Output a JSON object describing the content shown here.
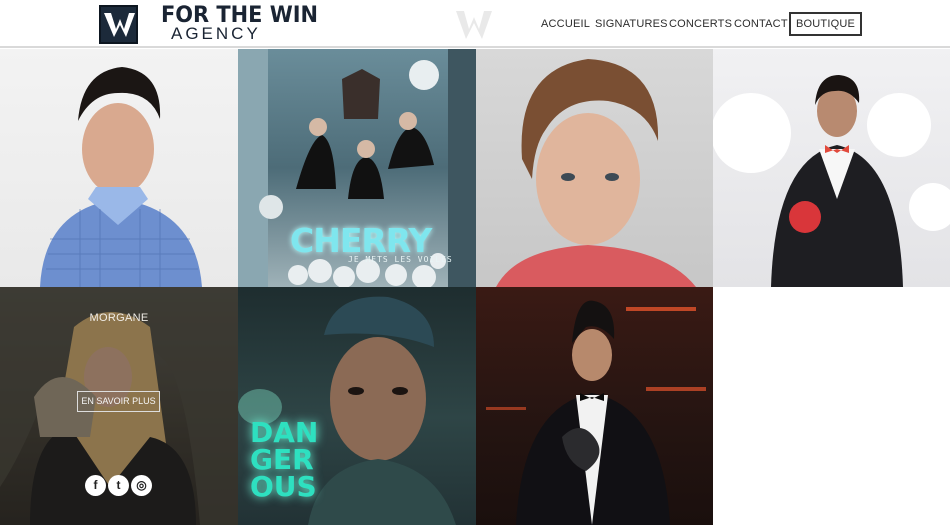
{
  "brand": {
    "line1": "FOR THE WIN",
    "line2": "AGENCY",
    "logo_icon": "w-logo-icon"
  },
  "nav": [
    {
      "label": "ACCUEIL"
    },
    {
      "label": "SIGNATURES"
    },
    {
      "label": "CONCERTS"
    },
    {
      "label": "CONTACT"
    },
    {
      "label": "BOUTIQUE"
    }
  ],
  "tiles": [
    {
      "id": "artist-1"
    },
    {
      "id": "artist-2",
      "title": "CHERRY",
      "subtitle": "JE METS LES VOILES"
    },
    {
      "id": "artist-3"
    },
    {
      "id": "artist-4"
    },
    {
      "id": "artist-5",
      "name": "MORGANE",
      "cta": "EN SAVOIR PLUS",
      "social": [
        "f",
        "t",
        "◎"
      ]
    },
    {
      "id": "artist-6",
      "title_lines": [
        "DAN",
        "GER",
        "OUS"
      ]
    },
    {
      "id": "artist-7"
    }
  ],
  "colors": {
    "brand": "#1a2433",
    "cherry": "#7fe6ee",
    "dangerous": "#2ee0c0"
  }
}
